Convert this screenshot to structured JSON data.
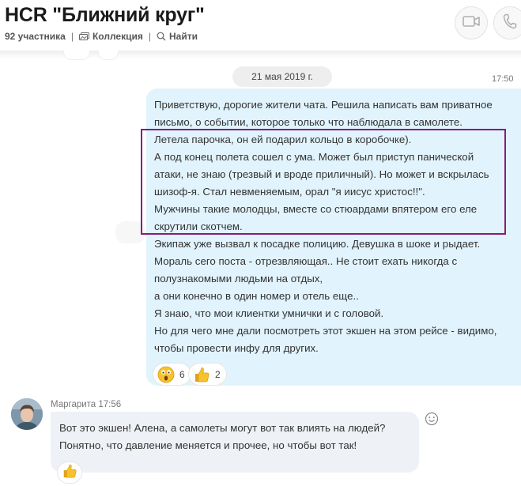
{
  "header": {
    "title": "HCR \"Ближний круг\"",
    "participants": "92 участника",
    "collection_label": "Коллекция",
    "find_label": "Найти",
    "separator": "|"
  },
  "conversation": {
    "date_label": "21 мая 2019 г.",
    "outgoing": {
      "time": "17:50",
      "lines": [
        "Приветствую, дорогие жители чата. Решила написать вам приватное",
        "письмо, о событии, которое только что наблюдала в самолете.",
        "Летела парочка, он ей подарил кольцо в коробочке).",
        "А под конец полета сошел с ума. Может был приступ панической",
        "атаки, не знаю (трезвый и вроде приличный). Но может и вскрылась",
        "шизоф-я. Стал невменяемым, орал \"я иисус христос!!\".",
        "Мужчины такие молодцы, вместе со стюардами впятером его еле",
        "скрутили скотчем.",
        "Экипаж уже вызвал к посадке полицию. Девушка в шоке и рыдает.",
        "Мораль сего поста - отрезвляющая.. Не стоит ехать никогда с",
        "полузнакомыми людьми на отдых,",
        "а они конечно в один номер и отель еще..",
        "Я знаю, что мои клиентки умнички и с головой.",
        "Но для чего мне дали посмотреть этот экшен на этом рейсе - видимо,",
        "чтобы провести инфу для других."
      ],
      "reactions": [
        {
          "icon": "surprised-emoji-icon",
          "count": "6"
        },
        {
          "icon": "thumbs-up-icon",
          "count": "2"
        }
      ]
    },
    "incoming": {
      "sender": "Маргарита 17:56",
      "lines": [
        "Вот это экшен! Алена, а самолеты могут вот так влиять на людей?",
        "Понятно, что давление меняется и прочее, но чтобы вот так!"
      ],
      "reaction_icon": "thumbs-up-icon"
    }
  },
  "colors": {
    "outgoing_bubble": "#e1f3fd",
    "incoming_bubble": "#eef1f5",
    "highlight_border": "#8b1a7a"
  }
}
